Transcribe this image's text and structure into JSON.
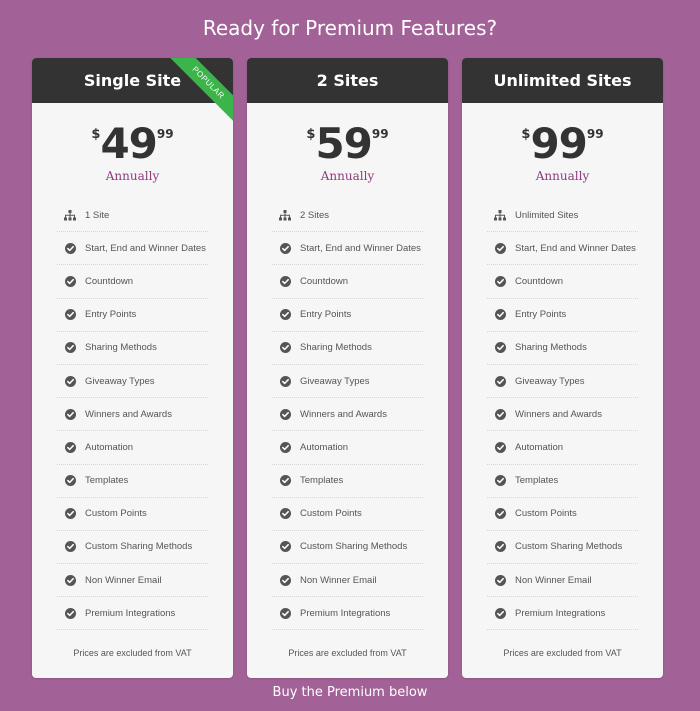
{
  "page": {
    "title": "Ready for Premium Features?",
    "cta": "Buy the Premium below"
  },
  "colors": {
    "background": "#a36297",
    "header": "#333333",
    "card": "#f6f6f6",
    "accent": "#8e3b7e",
    "ribbon": "#3bb54a"
  },
  "plans": [
    {
      "name": "Single Site",
      "ribbon": "POPULAR",
      "currency": "$",
      "amount": "49",
      "cents": "99",
      "period": "Annually",
      "note": "Prices are excluded from VAT",
      "features": [
        {
          "icon": "sitemap-icon",
          "label": "1 Site"
        },
        {
          "icon": "check-circle-icon",
          "label": "Start, End and Winner Dates"
        },
        {
          "icon": "check-circle-icon",
          "label": "Countdown"
        },
        {
          "icon": "check-circle-icon",
          "label": "Entry Points"
        },
        {
          "icon": "check-circle-icon",
          "label": "Sharing Methods"
        },
        {
          "icon": "check-circle-icon",
          "label": "Giveaway Types"
        },
        {
          "icon": "check-circle-icon",
          "label": "Winners and Awards"
        },
        {
          "icon": "check-circle-icon",
          "label": "Automation"
        },
        {
          "icon": "check-circle-icon",
          "label": "Templates"
        },
        {
          "icon": "check-circle-icon",
          "label": "Custom Points"
        },
        {
          "icon": "check-circle-icon",
          "label": "Custom Sharing Methods"
        },
        {
          "icon": "check-circle-icon",
          "label": "Non Winner Email"
        },
        {
          "icon": "check-circle-icon",
          "label": "Premium Integrations"
        }
      ]
    },
    {
      "name": "2 Sites",
      "ribbon": "",
      "currency": "$",
      "amount": "59",
      "cents": "99",
      "period": "Annually",
      "note": "Prices are excluded from VAT",
      "features": [
        {
          "icon": "sitemap-icon",
          "label": "2 Sites"
        },
        {
          "icon": "check-circle-icon",
          "label": "Start, End and Winner Dates"
        },
        {
          "icon": "check-circle-icon",
          "label": "Countdown"
        },
        {
          "icon": "check-circle-icon",
          "label": "Entry Points"
        },
        {
          "icon": "check-circle-icon",
          "label": "Sharing Methods"
        },
        {
          "icon": "check-circle-icon",
          "label": "Giveaway Types"
        },
        {
          "icon": "check-circle-icon",
          "label": "Winners and Awards"
        },
        {
          "icon": "check-circle-icon",
          "label": "Automation"
        },
        {
          "icon": "check-circle-icon",
          "label": "Templates"
        },
        {
          "icon": "check-circle-icon",
          "label": "Custom Points"
        },
        {
          "icon": "check-circle-icon",
          "label": "Custom Sharing Methods"
        },
        {
          "icon": "check-circle-icon",
          "label": "Non Winner Email"
        },
        {
          "icon": "check-circle-icon",
          "label": "Premium Integrations"
        }
      ]
    },
    {
      "name": "Unlimited Sites",
      "ribbon": "",
      "currency": "$",
      "amount": "99",
      "cents": "99",
      "period": "Annually",
      "note": "Prices are excluded from VAT",
      "features": [
        {
          "icon": "sitemap-icon",
          "label": "Unlimited Sites"
        },
        {
          "icon": "check-circle-icon",
          "label": "Start, End and Winner Dates"
        },
        {
          "icon": "check-circle-icon",
          "label": "Countdown"
        },
        {
          "icon": "check-circle-icon",
          "label": "Entry Points"
        },
        {
          "icon": "check-circle-icon",
          "label": "Sharing Methods"
        },
        {
          "icon": "check-circle-icon",
          "label": "Giveaway Types"
        },
        {
          "icon": "check-circle-icon",
          "label": "Winners and Awards"
        },
        {
          "icon": "check-circle-icon",
          "label": "Automation"
        },
        {
          "icon": "check-circle-icon",
          "label": "Templates"
        },
        {
          "icon": "check-circle-icon",
          "label": "Custom Points"
        },
        {
          "icon": "check-circle-icon",
          "label": "Custom Sharing Methods"
        },
        {
          "icon": "check-circle-icon",
          "label": "Non Winner Email"
        },
        {
          "icon": "check-circle-icon",
          "label": "Premium Integrations"
        }
      ]
    }
  ]
}
